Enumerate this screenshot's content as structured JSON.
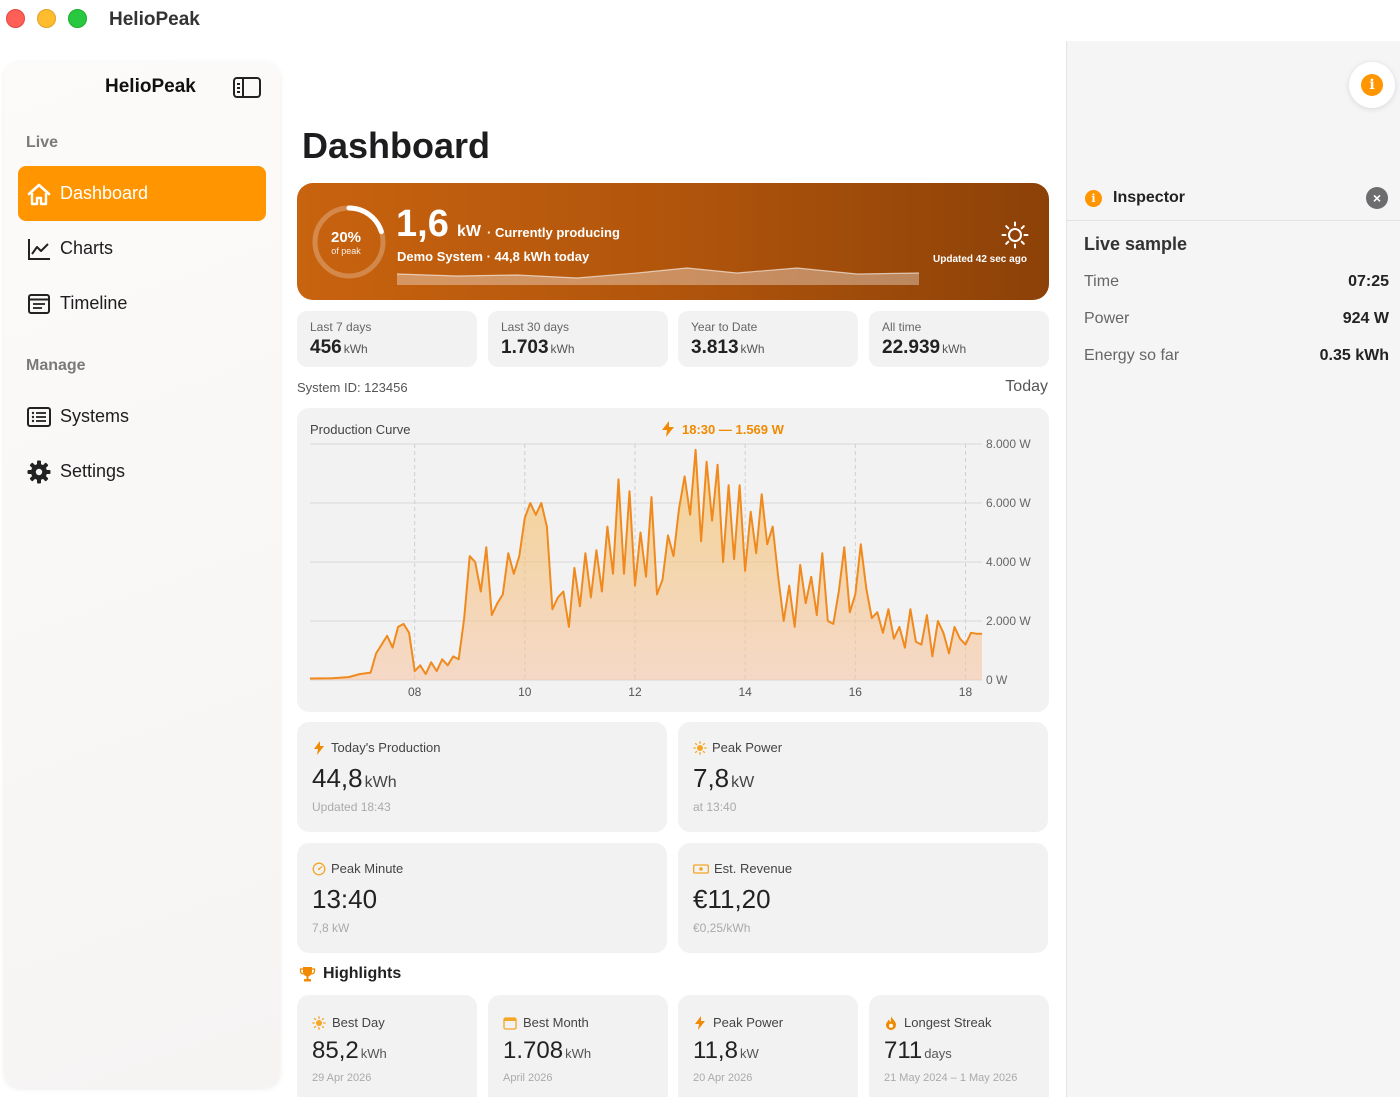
{
  "window": {
    "title": "HelioPeak"
  },
  "sidebar": {
    "title": "HelioPeak",
    "sections": {
      "live": "Live",
      "manage": "Manage"
    },
    "items": [
      {
        "label": "Dashboard",
        "icon": "house-icon",
        "active": true
      },
      {
        "label": "Charts",
        "icon": "line-chart-icon",
        "active": false
      },
      {
        "label": "Timeline",
        "icon": "timeline-icon",
        "active": false
      },
      {
        "label": "Systems",
        "icon": "list-icon",
        "active": false
      },
      {
        "label": "Settings",
        "icon": "gear-icon",
        "active": false
      }
    ]
  },
  "main": {
    "title": "Dashboard",
    "hero": {
      "percent": "20%",
      "percent_caption": "of peak",
      "percent_value": 0.2,
      "value": "1,6",
      "unit": "kW",
      "state": "· Currently producing",
      "system_line": "Demo System · 44,8 kWh today",
      "updated": "Updated 42 sec ago",
      "icon": "sun-icon"
    },
    "stats": [
      {
        "label": "Last 7 days",
        "value": "456",
        "unit": "kWh"
      },
      {
        "label": "Last 30 days",
        "value": "1.703",
        "unit": "kWh"
      },
      {
        "label": "Year to Date",
        "value": "3.813",
        "unit": "kWh"
      },
      {
        "label": "All time",
        "value": "22.939",
        "unit": "kWh"
      }
    ],
    "system_id": "System ID: 123456",
    "range": "Today",
    "cards": [
      {
        "label": "Today's Production",
        "icon": "bolt-icon",
        "value": "44,8",
        "unit": "kWh",
        "sub": "Updated 18:43"
      },
      {
        "label": "Peak Power",
        "icon": "sun-icon",
        "value": "7,8",
        "unit": "kW",
        "sub": "at 13:40"
      },
      {
        "label": "Peak Minute",
        "icon": "gauge-icon",
        "value": "13:40",
        "unit": "",
        "sub": "7,8 kW"
      },
      {
        "label": "Est. Revenue",
        "icon": "banknote-icon",
        "value": "€11,20",
        "unit": "",
        "sub": "€0,25/kWh"
      }
    ],
    "highlights": {
      "title": "Highlights",
      "items": [
        {
          "label": "Best Day",
          "icon": "sun-icon",
          "value": "85,2",
          "unit": "kWh",
          "sub": "29 Apr 2026"
        },
        {
          "label": "Best Month",
          "icon": "calendar-icon",
          "value": "1.708",
          "unit": "kWh",
          "sub": "April 2026"
        },
        {
          "label": "Peak Power",
          "icon": "bolt-icon",
          "value": "11,8",
          "unit": "kW",
          "sub": "20 Apr 2026"
        },
        {
          "label": "Longest Streak",
          "icon": "flame-icon",
          "value": "711",
          "unit": "days",
          "sub": "21 May 2024 – 1 May 2026"
        }
      ]
    }
  },
  "inspector": {
    "title": "Inspector",
    "section": "Live sample",
    "rows": [
      {
        "key": "Time",
        "value": "07:25"
      },
      {
        "key": "Power",
        "value": "924 W"
      },
      {
        "key": "Energy so far",
        "value": "0.35 kWh"
      }
    ]
  },
  "colors": {
    "accent": "#ff9500",
    "hero_start": "#c8630f",
    "hero_end": "#8c4108",
    "line": "#f08a1e"
  },
  "chart_data": {
    "type": "area",
    "title": "Production Curve",
    "annotation": "18:30 — 1.569 W",
    "x_ticks": [
      "08",
      "10",
      "12",
      "14",
      "16",
      "18"
    ],
    "y_ticks": [
      "8.000 W",
      "6.000 W",
      "4.000 W",
      "2.000 W",
      "0 W"
    ],
    "xlim": [
      6.1,
      18.3
    ],
    "ylim": [
      0,
      8000
    ],
    "grid": true,
    "series": [
      {
        "x": [
          6.1,
          6.5,
          6.8,
          7.0,
          7.2,
          7.3,
          7.5,
          7.6,
          7.7,
          7.8,
          7.9,
          8.0,
          8.1,
          8.2,
          8.3,
          8.4,
          8.5,
          8.6,
          8.7,
          8.8,
          8.9,
          9.0,
          9.1,
          9.2,
          9.3,
          9.4,
          9.5,
          9.6,
          9.7,
          9.8,
          9.9,
          10.0,
          10.1,
          10.2,
          10.3,
          10.4,
          10.5,
          10.6,
          10.7,
          10.8,
          10.9,
          11.0,
          11.1,
          11.2,
          11.3,
          11.4,
          11.5,
          11.6,
          11.7,
          11.8,
          11.9,
          12.0,
          12.1,
          12.2,
          12.3,
          12.4,
          12.5,
          12.6,
          12.7,
          12.8,
          12.9,
          13.0,
          13.1,
          13.2,
          13.3,
          13.4,
          13.5,
          13.6,
          13.7,
          13.8,
          13.9,
          14.0,
          14.1,
          14.2,
          14.3,
          14.4,
          14.5,
          14.6,
          14.7,
          14.8,
          14.9,
          15.0,
          15.1,
          15.2,
          15.3,
          15.4,
          15.5,
          15.6,
          15.7,
          15.8,
          15.9,
          16.0,
          16.1,
          16.2,
          16.3,
          16.4,
          16.5,
          16.6,
          16.7,
          16.8,
          16.9,
          17.0,
          17.1,
          17.2,
          17.3,
          17.4,
          17.5,
          17.6,
          17.7,
          17.8,
          17.9,
          18.0,
          18.1,
          18.2,
          18.3
        ],
        "y": [
          50,
          60,
          100,
          200,
          250,
          900,
          1500,
          1100,
          1800,
          1900,
          1600,
          300,
          500,
          200,
          600,
          300,
          700,
          500,
          800,
          700,
          2100,
          4200,
          4000,
          3000,
          4500,
          2200,
          2600,
          2900,
          4300,
          3600,
          4200,
          5500,
          6000,
          5600,
          6000,
          5200,
          2400,
          2800,
          3000,
          1800,
          3800,
          2500,
          4300,
          2800,
          4400,
          3000,
          5200,
          3600,
          6800,
          3600,
          6400,
          3200,
          5000,
          3500,
          6200,
          2900,
          3400,
          4900,
          4200,
          5800,
          6900,
          5600,
          7800,
          4700,
          7400,
          5400,
          7300,
          4000,
          6600,
          4100,
          6600,
          3700,
          5700,
          4300,
          6300,
          4600,
          5200,
          3500,
          2000,
          3200,
          1800,
          3900,
          2600,
          3500,
          2200,
          4300,
          2000,
          1900,
          3000,
          4500,
          2300,
          2900,
          4600,
          3100,
          2100,
          2300,
          1600,
          2400,
          1400,
          1800,
          1100,
          2400,
          1300,
          1200,
          2200,
          800,
          2000,
          1600,
          900,
          1800,
          1400,
          1200,
          1600,
          1569,
          1569
        ]
      }
    ]
  }
}
